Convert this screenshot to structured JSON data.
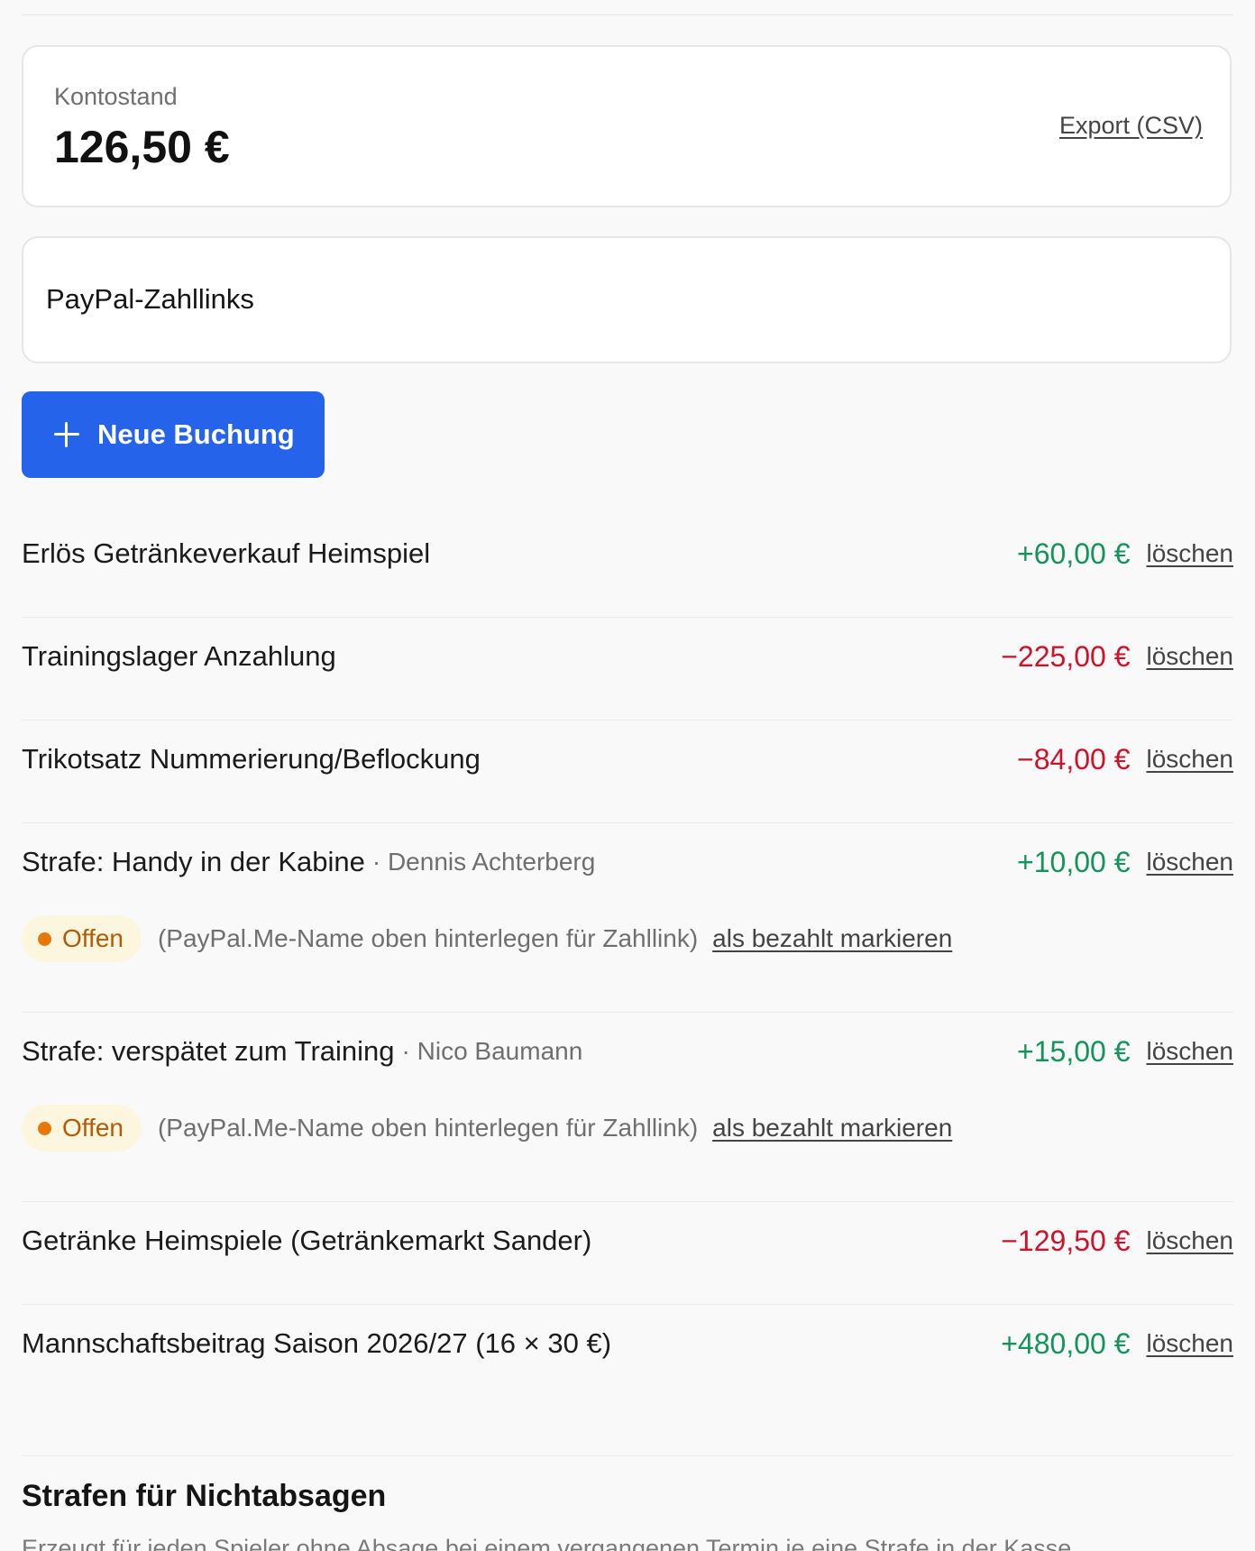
{
  "balance": {
    "label": "Kontostand",
    "value": "126,50 €",
    "export_label": "Export (CSV)"
  },
  "paypal": {
    "title": "PayPal-Zahllinks"
  },
  "new_booking": {
    "label": "Neue Buchung",
    "icon": "plus-icon"
  },
  "delete_label": "löschen",
  "entries": [
    {
      "title": "Erlös Getränkeverkauf Heimspiel",
      "person": "",
      "amount": "+60,00 €",
      "sign": "positive"
    },
    {
      "title": "Trainingslager Anzahlung",
      "person": "",
      "amount": "−225,00 €",
      "sign": "negative"
    },
    {
      "title": "Trikotsatz Nummerierung/Beflockung",
      "person": "",
      "amount": "−84,00 €",
      "sign": "negative"
    },
    {
      "title": "Strafe: Handy in der Kabine",
      "person": "· Dennis Achterberg",
      "amount": "+10,00 €",
      "sign": "positive",
      "status": {
        "label": "Offen",
        "note": "(PayPal.Me-Name oben hinterlegen für Zahllink)",
        "action": "als bezahlt markieren"
      }
    },
    {
      "title": "Strafe: verspätet zum Training",
      "person": "· Nico Baumann",
      "amount": "+15,00 €",
      "sign": "positive",
      "status": {
        "label": "Offen",
        "note": "(PayPal.Me-Name oben hinterlegen für Zahllink)",
        "action": "als bezahlt markieren"
      }
    },
    {
      "title": "Getränke Heimspiele (Getränkemarkt Sander)",
      "person": "",
      "amount": "−129,50 €",
      "sign": "negative"
    },
    {
      "title": "Mannschaftsbeitrag Saison 2026/27 (16 × 30 €)",
      "person": "",
      "amount": "+480,00 €",
      "sign": "positive"
    }
  ],
  "colors": {
    "positive": "#14935a",
    "negative": "#d0112b",
    "accent": "#2563eb",
    "status_open": "#e67709"
  },
  "penalty_section": {
    "title": "Strafen für Nichtabsagen",
    "subtitle": "Erzeugt für jeden Spieler ohne Absage bei einem vergangenen Termin je eine Strafe in der Kasse."
  }
}
